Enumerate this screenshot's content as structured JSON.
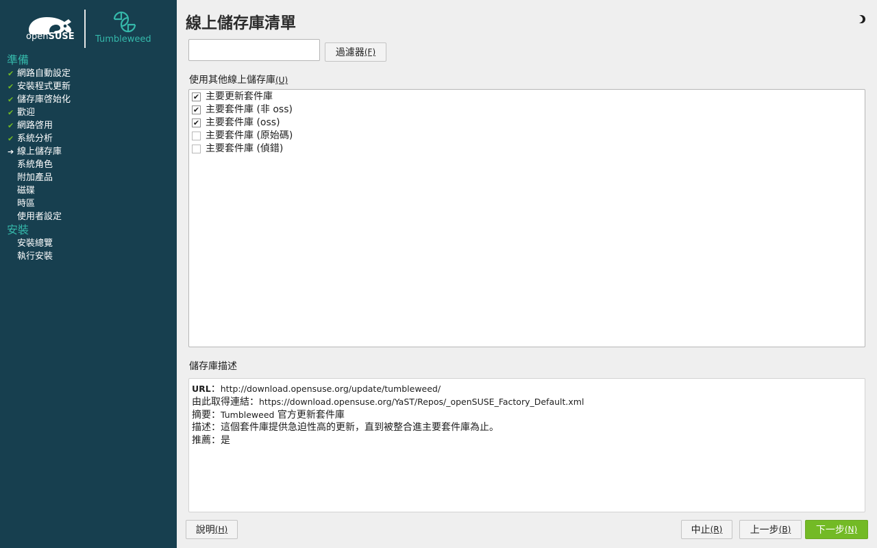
{
  "brand": {
    "suse_text_light": "open",
    "suse_text_bold": "SUSE",
    "product": "Tumbleweed"
  },
  "sidebar": {
    "stages": [
      {
        "title": "準備",
        "steps": [
          {
            "label": "網路自動設定",
            "status": "done"
          },
          {
            "label": "安裝程式更新",
            "status": "done"
          },
          {
            "label": "儲存庫啓始化",
            "status": "done"
          },
          {
            "label": "歡迎",
            "status": "done"
          },
          {
            "label": "網路啓用",
            "status": "done"
          },
          {
            "label": "系統分析",
            "status": "done"
          },
          {
            "label": "線上儲存庫",
            "status": "current"
          },
          {
            "label": "系統角色",
            "status": "pending"
          },
          {
            "label": "附加產品",
            "status": "pending"
          },
          {
            "label": "磁碟",
            "status": "pending"
          },
          {
            "label": "時區",
            "status": "pending"
          },
          {
            "label": "使用者設定",
            "status": "pending"
          }
        ]
      },
      {
        "title": "安裝",
        "steps": [
          {
            "label": "安裝總覽",
            "status": "pending"
          },
          {
            "label": "執行安裝",
            "status": "pending"
          }
        ]
      }
    ],
    "marks": {
      "done": "✔",
      "current": "➔"
    }
  },
  "main": {
    "title": "線上儲存庫清單",
    "filter": {
      "value": "",
      "button_label": "過濾器",
      "button_shortcut": "(F)"
    },
    "repo_section": {
      "label": "使用其他線上儲存庫",
      "shortcut": "(U)",
      "items": [
        {
          "name": "主要更新套件庫",
          "checked": true
        },
        {
          "name": "主要套件庫 (非 oss)",
          "checked": true
        },
        {
          "name": "主要套件庫 (oss)",
          "checked": true
        },
        {
          "name": "主要套件庫 (原始碼)",
          "checked": false
        },
        {
          "name": "主要套件庫 (偵錯)",
          "checked": false
        }
      ]
    },
    "description": {
      "label": "儲存庫描述",
      "url_label": "URL",
      "url_sep": "：",
      "url_value": "http://download.opensuse.org/update/tumbleweed/",
      "source_label": "由此取得連結：",
      "source_value": "https://download.opensuse.org/YaST/Repos/_openSUSE_Factory_Default.xml",
      "summary_label": "摘要：",
      "summary_value_en": "Tumbleweed",
      "summary_value_zh": " 官方更新套件庫",
      "desc_label": "描述：",
      "desc_value": "這個套件庫提供急迫性高的更新，直到被整合進主要套件庫為止。",
      "recommended_label": "推薦：",
      "recommended_value": "是"
    }
  },
  "buttons": {
    "help": {
      "label": "說明",
      "shortcut": "(H)"
    },
    "abort": {
      "label": "中止",
      "shortcut": "(R)"
    },
    "back": {
      "label": "上一步",
      "shortcut": "(B)"
    },
    "next": {
      "label": "下一步",
      "shortcut": "(N)"
    }
  },
  "colors": {
    "sidebar_bg": "#173f4f",
    "accent_teal": "#35b9ab",
    "accent_green": "#73ba25",
    "content_bg": "#efefef"
  },
  "icons": {
    "theme_toggle": "half-moon-icon",
    "product_logo": "tumbleweed-icon",
    "brand_logo": "chameleon-logo-icon"
  }
}
